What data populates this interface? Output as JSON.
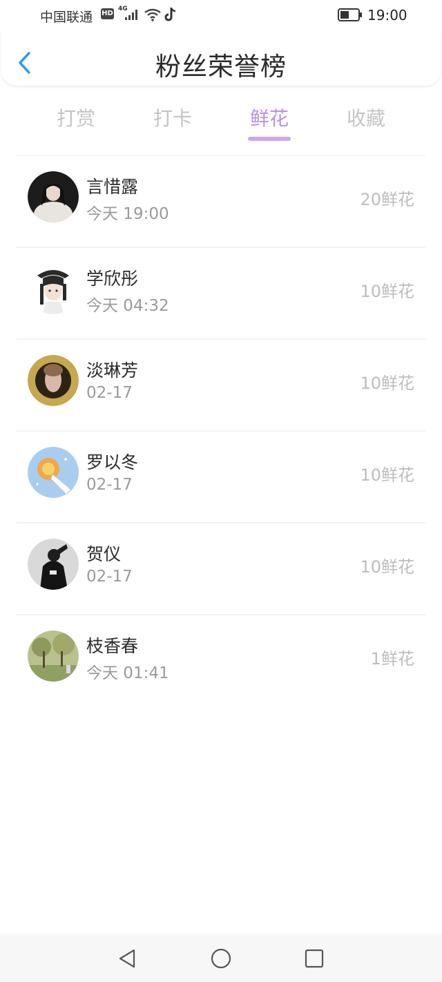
{
  "status_bar": {
    "carrier": "中国联通",
    "hd": "HD",
    "network": "4G",
    "time": "19:00"
  },
  "header": {
    "title": "粉丝荣誉榜",
    "back_icon": "chevron-left-icon"
  },
  "tabs": [
    {
      "label": "打赏",
      "active": false
    },
    {
      "label": "打卡",
      "active": false
    },
    {
      "label": "鲜花",
      "active": true
    },
    {
      "label": "收藏",
      "active": false
    }
  ],
  "colors": {
    "accent": "#b891e6",
    "back_icon": "#2f9bea",
    "inactive_tab": "#c4c4c4",
    "count_text": "#bdbdbd"
  },
  "fans": [
    {
      "name": "言惜露",
      "time": "今天 19:00",
      "count": "20鲜花"
    },
    {
      "name": "学欣彤",
      "time": "今天 04:32",
      "count": "10鲜花"
    },
    {
      "name": "淡琳芳",
      "time": "02-17",
      "count": "10鲜花"
    },
    {
      "name": "罗以冬",
      "time": "02-17",
      "count": "10鲜花"
    },
    {
      "name": "贺仪",
      "time": "02-17",
      "count": "10鲜花"
    },
    {
      "name": "枝香春",
      "time": "今天 01:41",
      "count": "1鲜花"
    }
  ],
  "nav_bar": {
    "buttons": [
      "back-triangle-icon",
      "home-circle-icon",
      "recents-square-icon"
    ]
  }
}
